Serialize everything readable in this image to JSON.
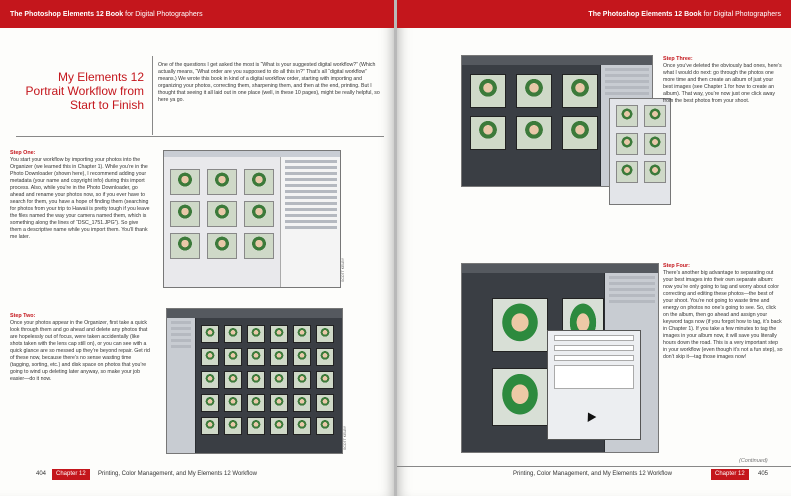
{
  "book": {
    "title_bold": "The Photoshop Elements 12 Book",
    "title_rest": "for Digital Photographers",
    "accent_color": "#c4161c"
  },
  "left_page": {
    "page_number": "404",
    "chapter": "Chapter 12",
    "footer_title": "Printing, Color Management, and My Elements 12 Workflow",
    "title": "My Elements 12 Portrait Workflow from Start to Finish",
    "intro": "One of the questions I get asked the most is “What is your suggested digital workflow?” (Which actually means, “What order are you supposed to do all this in?” That’s all “digital workflow” means.) We wrote this book in kind of a digital workflow order, starting with importing and organizing your photos, correcting them, sharpening them, and then at the end, printing. But I thought that seeing it all laid out in one place (well, in these 10 pages), might be really helpful, so here ya go.",
    "step1_head": "Step One:",
    "step1_body": "You start your workflow by importing your photos into the Organizer (we learned this in Chapter 1). While you’re in the Photo Downloader (shown here), I recommend adding your metadata (your name and copyright info) during this import process. Also, while you’re in the Photo Downloader, go ahead and rename your photos now, so if you ever have to search for them, you have a hope of finding them (searching for photos from your trip to Hawaii is pretty tough if you leave the files named the way your camera named them, which is something along the lines of “DSC_1751.JPG”). So give them a descriptive name while you import them. You’ll thank me later.",
    "step2_head": "Step Two:",
    "step2_body": "Once your photos appear in the Organizer, first take a quick look through them and go ahead and delete any photos that are hopelessly out of focus, were taken accidentally (like shots taken with the lens cap still on), or you can see with a quick glance are so messed up they’re beyond repair. Get rid of these now, because there’s no sense wasting time (tagging, sorting, etc.) and disk space on photos that you’re going to wind up deleting later anyway, so make your job easier—do it now.",
    "credit1": "SCOTT KELBY",
    "credit2": "SCOTT KELBY"
  },
  "right_page": {
    "page_number": "405",
    "chapter": "Chapter 12",
    "footer_title": "Printing, Color Management, and My Elements 12 Workflow",
    "step3_head": "Step Three:",
    "step3_body": "Once you’ve deleted the obviously bad ones, here’s what I would do next: go through the photos one more time and then create an album of just your best images (see Chapter 1 for how to create an album). That way, you’re now just one click away from the best photos from your shoot.",
    "step4_head": "Step Four:",
    "step4_body": "There’s another big advantage to separating out your best images into their own separate album: now you’re only going to tag and worry about color correcting and editing these photos—the best of your shoot. You’re not going to waste time and energy on photos no one’s going to see. So, click on the album, then go ahead and assign your keyword tags now (if you forgot how to tag, it’s back in Chapter 1). If you take a few minutes to tag the images in your album now, it will save you literally hours down the road. This is a very important step in your workflow (even though it’s not a fun step), so don’t skip it—tag those images now!",
    "continued": "(Continued)"
  }
}
